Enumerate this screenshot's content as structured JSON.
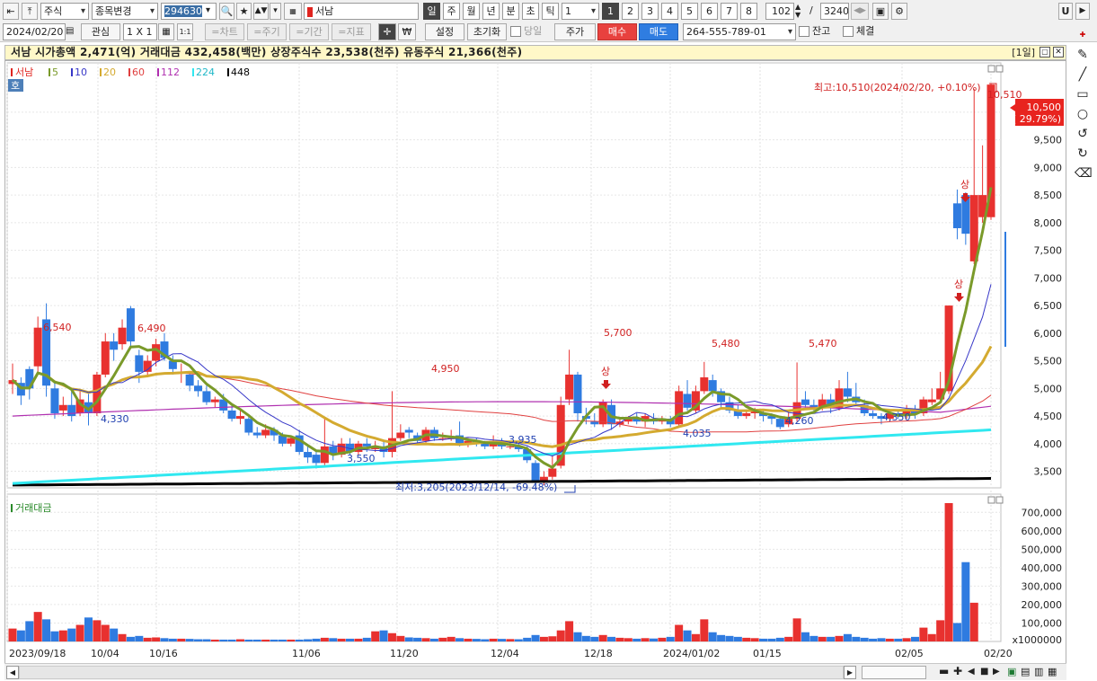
{
  "toolbar1": {
    "market": "주식",
    "change_label": "종목변경",
    "code": "294630",
    "stock_name": "서남",
    "periods": [
      "일",
      "주",
      "월",
      "년",
      "분",
      "초",
      "틱"
    ],
    "active_period": "일",
    "interval_value": "1",
    "pages": [
      "1",
      "2",
      "3",
      "4",
      "5",
      "6",
      "7",
      "8"
    ],
    "active_page": "1",
    "count": "102",
    "slash": "/",
    "total": "3240",
    "u_label": "U"
  },
  "toolbar2": {
    "date": "2024/02/20",
    "watch_label": "관심",
    "grid_label": "1 X 1",
    "ratio_label": "1:1",
    "btn_chart": "=차트",
    "btn_cycle": "=주기",
    "btn_period": "=기간",
    "btn_indicator": "=지표",
    "won": "₩",
    "settings_label": "설정",
    "reset_label": "초기화",
    "today_label": "당일",
    "price_label": "주가",
    "buy_label": "매수",
    "sell_label": "매도",
    "account": "264-555-789-01",
    "balance_label": "잔고",
    "fill_label": "체결"
  },
  "info_bar": {
    "text": "서남  시가총액 2,471(억)  거래대금 432,458(백만)  상장주식수 23,538(천주)  유동주식 21,366(천주)",
    "period_tag": "[1일]"
  },
  "price_panel": {
    "legend_name": "서남",
    "ma_labels": [
      "5",
      "10",
      "20",
      "60",
      "112",
      "224",
      "448"
    ],
    "ma_colors": [
      "#7a9a2a",
      "#3838c8",
      "#d4aa30",
      "#e04040",
      "#b030b0",
      "#30e8f0",
      "#000000"
    ],
    "tag": "호",
    "y_ticks": [
      "10,000",
      "9,500",
      "9,000",
      "8,500",
      "8,000",
      "7,500",
      "7,000",
      "6,500",
      "6,000",
      "5,500",
      "5,000",
      "4,500",
      "4,000",
      "3,500"
    ],
    "high_note": "최고:10,510(2024/02/20, +0.10%)",
    "low_note": "최저:3,205(2023/12/14, -69.48%)",
    "current_price": "10,500",
    "current_change": "( 29.79%)",
    "peak_labels": [
      {
        "t": "6,540",
        "c": "#d02020"
      },
      {
        "t": "6,490",
        "c": "#d02020"
      },
      {
        "t": "4,330",
        "c": "#2040b0"
      },
      {
        "t": "3,550",
        "c": "#2040b0"
      },
      {
        "t": "4,950",
        "c": "#d02020"
      },
      {
        "t": "3,935",
        "c": "#2040b0"
      },
      {
        "t": "5,700",
        "c": "#d02020"
      },
      {
        "t": "4,035",
        "c": "#2040b0"
      },
      {
        "t": "5,480",
        "c": "#d02020"
      },
      {
        "t": "4,260",
        "c": "#2040b0"
      },
      {
        "t": "5,470",
        "c": "#d02020"
      },
      {
        "t": "4,350",
        "c": "#2040b0"
      },
      {
        "t": "10,510",
        "c": "#d02020"
      }
    ],
    "limit_up_label": "상"
  },
  "volume_panel": {
    "legend": "거래대금",
    "y_ticks": [
      "700,000",
      "600,000",
      "500,000",
      "400,000",
      "300,000",
      "200,000",
      "100,000"
    ],
    "unit": "x1000000"
  },
  "x_axis": {
    "labels": [
      "2023/09/18",
      "10/04",
      "10/16",
      "11/06",
      "11/20",
      "12/04",
      "12/18",
      "2024/01/02",
      "01/15",
      "02/05",
      "02/20"
    ]
  },
  "colors": {
    "up": "#e8312f",
    "down": "#2f7be0",
    "accent": "#3a6ea5"
  },
  "chart_data": {
    "type": "candlestick",
    "title": "서남",
    "x": [
      "2023/09/18",
      "10/04",
      "10/16",
      "11/06",
      "11/20",
      "12/04",
      "12/18",
      "2024/01/02",
      "01/15",
      "02/05",
      "02/20"
    ],
    "y_range": [
      3200,
      10600
    ],
    "high": {
      "value": 10510,
      "date": "2024/02/20"
    },
    "low": {
      "value": 3205,
      "date": "2023/12/14"
    },
    "labeled_extremes": [
      6540,
      6490,
      4330,
      3550,
      4950,
      3935,
      5700,
      4035,
      5480,
      4260,
      5470,
      4350,
      10510
    ],
    "last_close": 10500,
    "last_change_pct": 29.79,
    "volume_unit": "x1000000",
    "volume_max": 750000
  }
}
